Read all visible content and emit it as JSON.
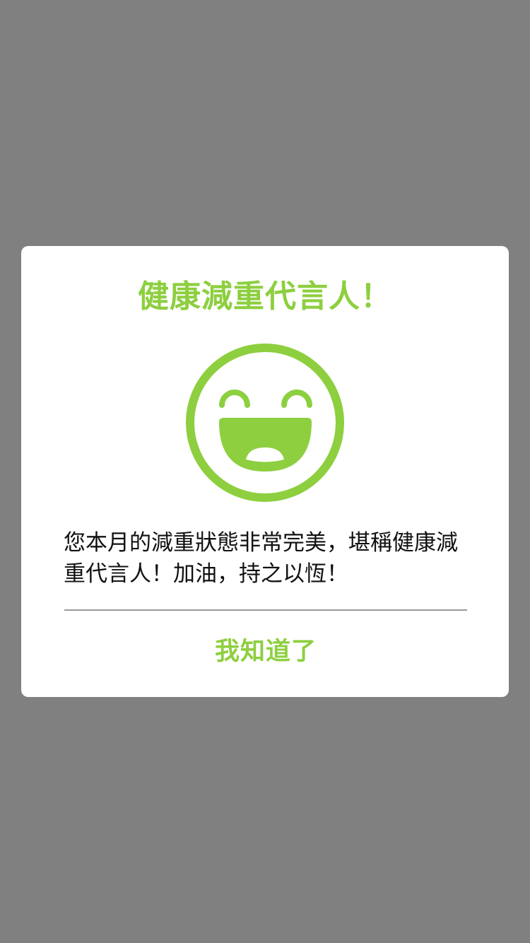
{
  "dialog": {
    "title": "健康減重代言人！",
    "message": "您本月的減重狀態非常完美，堪稱健康減重代言人！加油，持之以恆！",
    "confirm_label": "我知道了",
    "icon": "smiley-face-icon"
  },
  "colors": {
    "backdrop": "#808080",
    "accent": "#8dcf3f",
    "dialog_background": "#ffffff",
    "text": "#111111",
    "divider": "#9a9a9a"
  }
}
